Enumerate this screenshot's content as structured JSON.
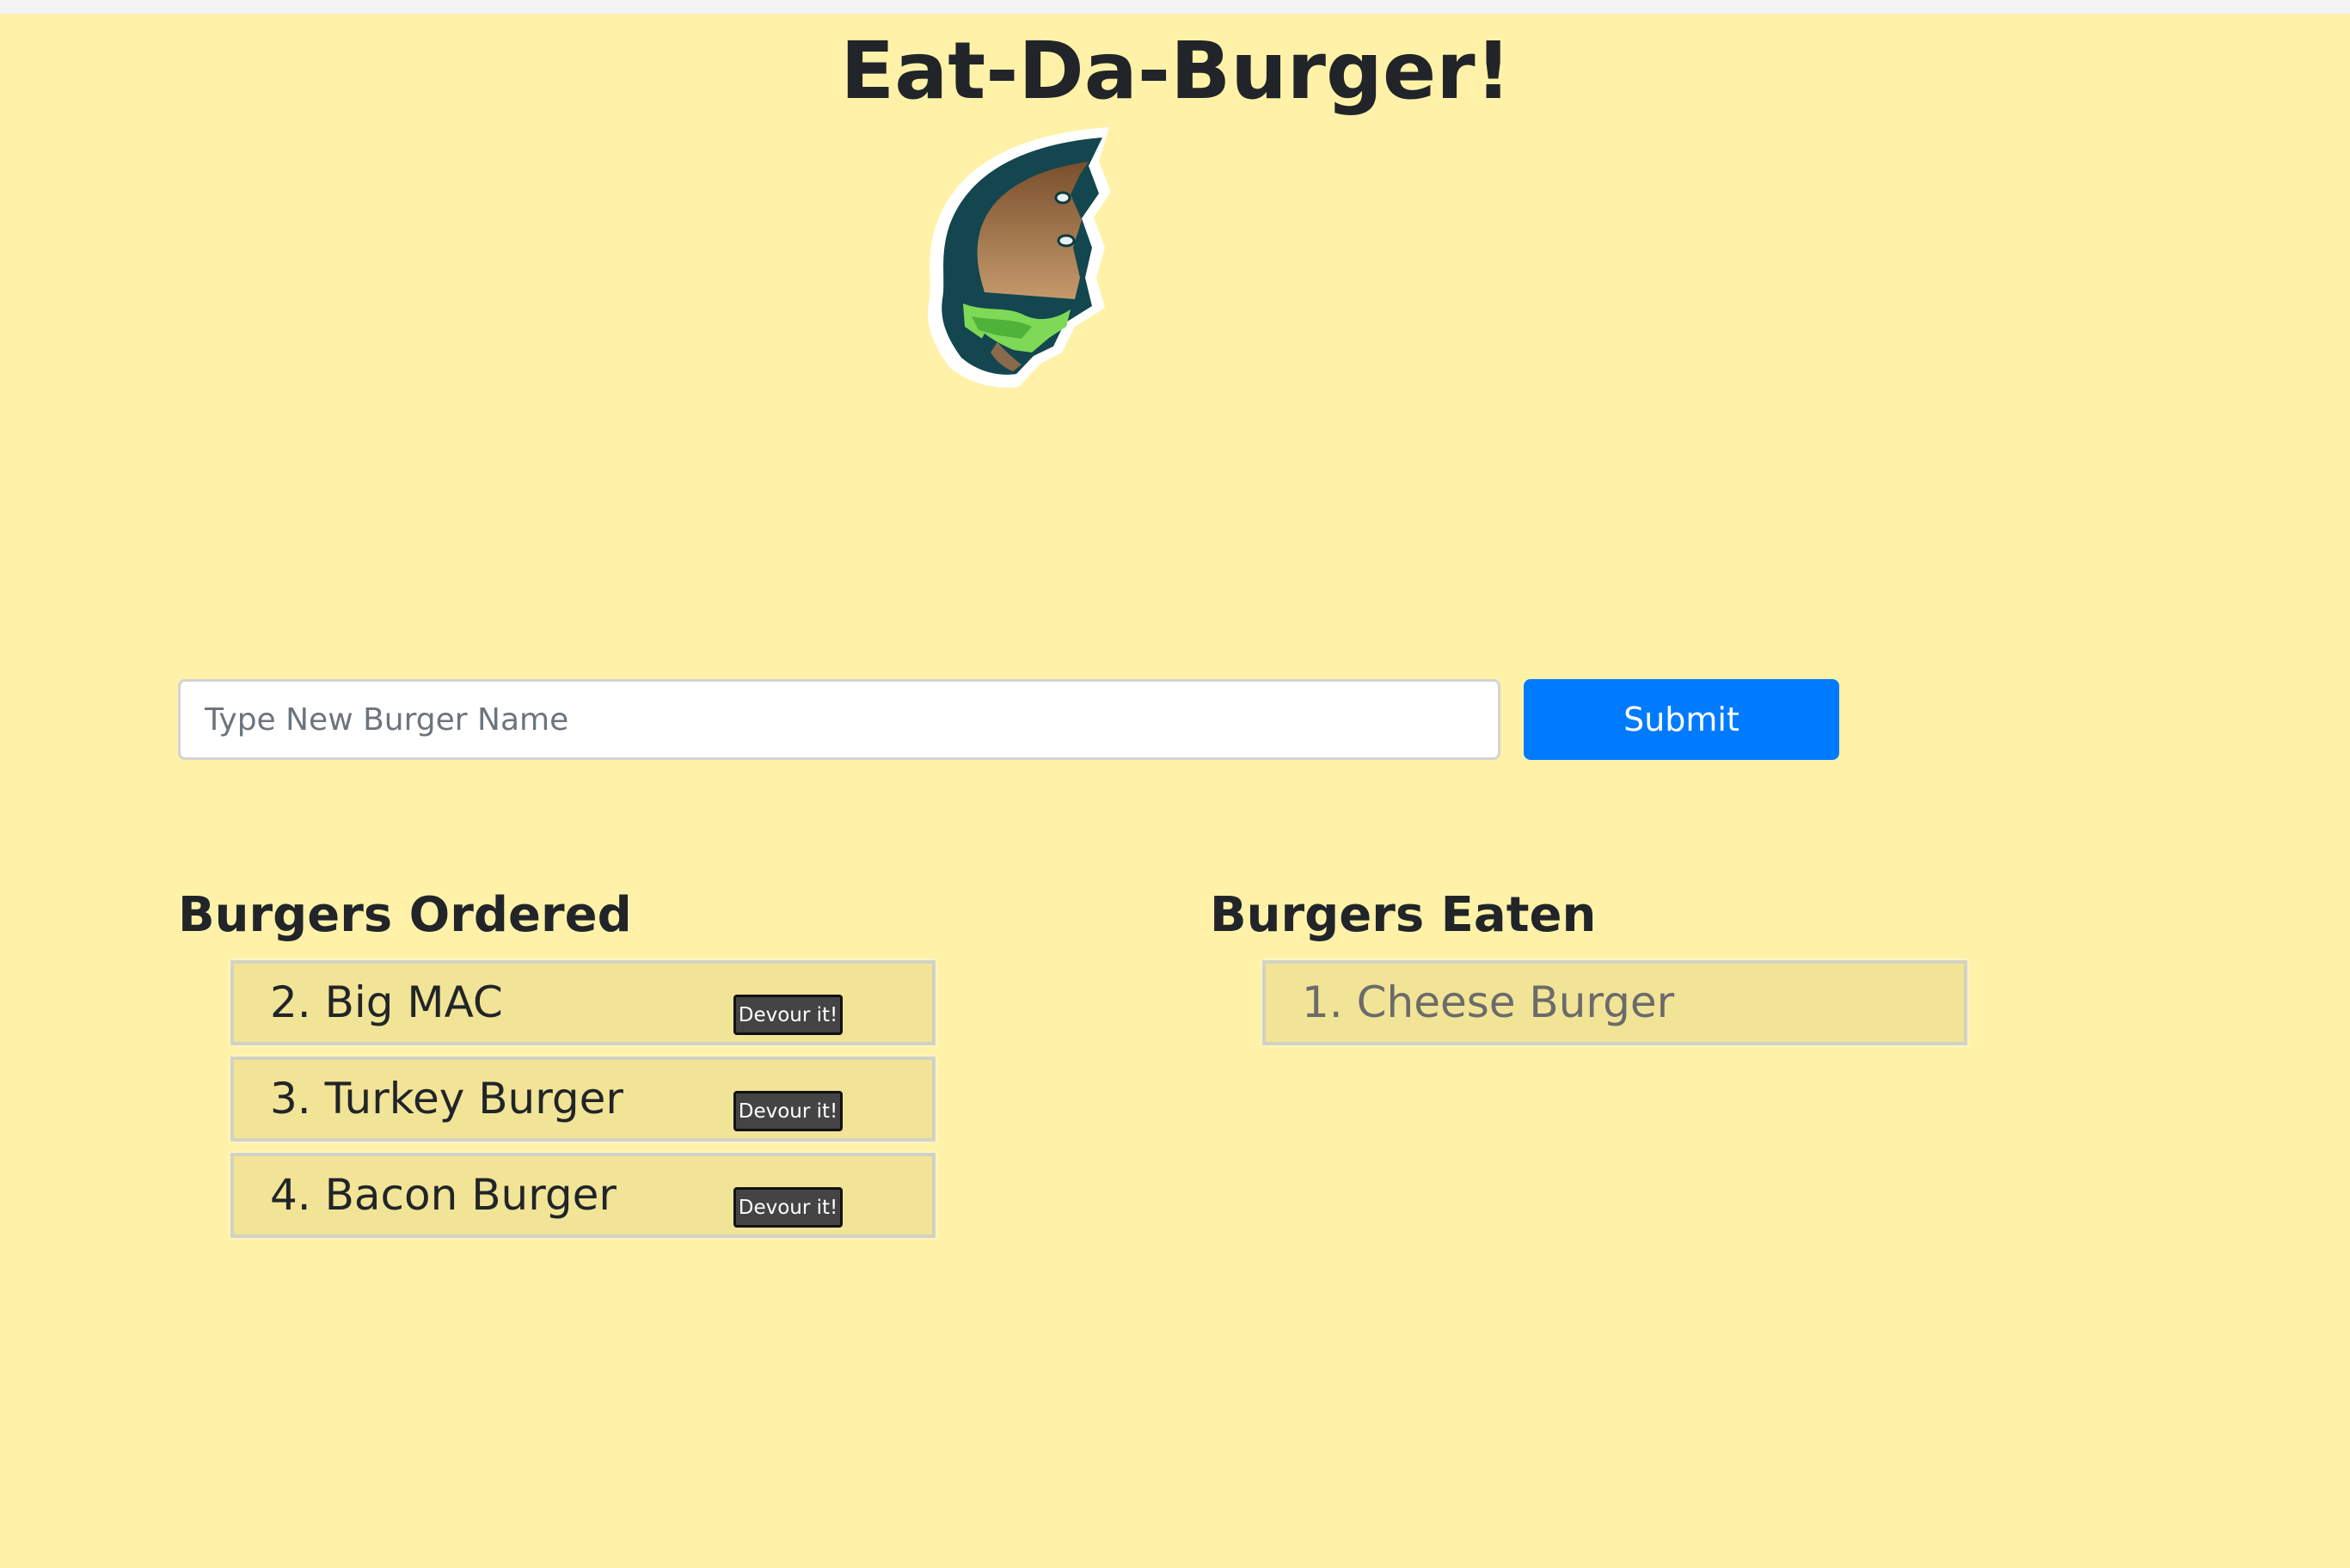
{
  "header": {
    "title": "Eat-Da-Burger!"
  },
  "logo": {
    "icon": "bitten-burger-icon"
  },
  "form": {
    "input_placeholder": "Type New Burger Name",
    "input_value": "",
    "submit_label": "Submit",
    "submit_color": "#007bff"
  },
  "ordered": {
    "heading": "Burgers Ordered",
    "devour_label": "Devour it!",
    "items": [
      {
        "label": "2. Big MAC"
      },
      {
        "label": "3. Turkey Burger"
      },
      {
        "label": "4. Bacon Burger"
      }
    ]
  },
  "eaten": {
    "heading": "Burgers Eaten",
    "items": [
      {
        "label": "1. Cheese Burger"
      }
    ]
  },
  "colors": {
    "background": "#fff2a8",
    "list_item_background": "#f2e496",
    "devour_button": "#444444"
  }
}
